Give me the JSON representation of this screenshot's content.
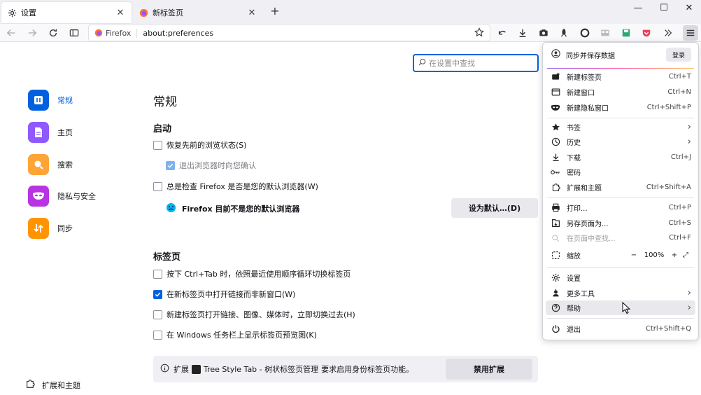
{
  "tabs": [
    {
      "label": "设置",
      "icon": "gear-icon"
    },
    {
      "label": "新标签页",
      "icon": "firefox-icon"
    }
  ],
  "navbar": {
    "identity_label": "Firefox",
    "url": "about:preferences"
  },
  "sidebar": {
    "categories": [
      {
        "label": "常规",
        "icon": "general-icon",
        "color": "#0061e0"
      },
      {
        "label": "主页",
        "icon": "home-icon",
        "color": "#9059ff"
      },
      {
        "label": "搜索",
        "icon": "search-icon",
        "color": "#ffa436"
      },
      {
        "label": "隐私与安全",
        "icon": "mask-icon",
        "color": "#b833e1"
      },
      {
        "label": "同步",
        "icon": "sync-icon",
        "color": "#ff9400"
      }
    ],
    "footer_label": "扩展和主题"
  },
  "search": {
    "placeholder": "在设置中查找"
  },
  "main": {
    "title": "常规",
    "startup": {
      "heading": "启动",
      "restore_session": "恢复先前的浏览状态(S)",
      "warn_on_quit": "退出浏览器时向您确认",
      "check_default": "总是检查 Firefox 是否是您的默认浏览器(W)",
      "not_default_text": "Firefox 目前不是您的默认浏览器",
      "set_default_button": "设为默认…(D)"
    },
    "tabs_section": {
      "heading": "标签页",
      "ctrl_tab": "按下 Ctrl+Tab 时，依照最近使用顺序循环切换标签页",
      "open_links_in_tabs": "在新标签页中打开链接而非新窗口(W)",
      "switch_to_new_tab": "新建标签页打开链接、图像、媒体时，立即切换过去(H)",
      "taskbar_previews": "在 Windows 任务栏上显示标签页预览图(K)"
    },
    "extension_notice": {
      "prefix": "扩展",
      "extension_name": "Tree Style Tab - 树状标签页管理",
      "message": "要求启用身份标签页功能。",
      "button": "禁用扩展"
    }
  },
  "app_menu": {
    "sync_label": "同步并保存数据",
    "login_label": "登录",
    "items": [
      {
        "label": "新建标签页",
        "shortcut": "Ctrl+T",
        "icon": "new-tab-icon"
      },
      {
        "label": "新建窗口",
        "shortcut": "Ctrl+N",
        "icon": "new-window-icon"
      },
      {
        "label": "新建隐私窗口",
        "shortcut": "Ctrl+Shift+P",
        "icon": "private-window-icon"
      },
      {
        "label": "书签",
        "icon": "star-icon"
      },
      {
        "label": "历史",
        "icon": "history-icon"
      },
      {
        "label": "下载",
        "shortcut": "Ctrl+J",
        "icon": "download-icon"
      },
      {
        "label": "密码",
        "icon": "key-icon"
      },
      {
        "label": "扩展和主题",
        "shortcut": "Ctrl+Shift+A",
        "icon": "puzzle-icon"
      },
      {
        "label": "打印...",
        "shortcut": "Ctrl+P",
        "icon": "print-icon"
      },
      {
        "label": "另存页面为...",
        "shortcut": "Ctrl+S",
        "icon": "save-page-icon"
      },
      {
        "label": "在页面中查找...",
        "shortcut": "Ctrl+F",
        "icon": "find-icon"
      },
      {
        "label": "缩放",
        "icon": "zoom-icon"
      },
      {
        "label": "设置",
        "icon": "gear-icon"
      },
      {
        "label": "更多工具",
        "icon": "tools-icon"
      },
      {
        "label": "帮助",
        "icon": "help-icon"
      },
      {
        "label": "退出",
        "shortcut": "Ctrl+Shift+Q",
        "icon": "power-icon"
      }
    ],
    "zoom": {
      "minus": "−",
      "value": "100%",
      "plus": "+"
    }
  }
}
